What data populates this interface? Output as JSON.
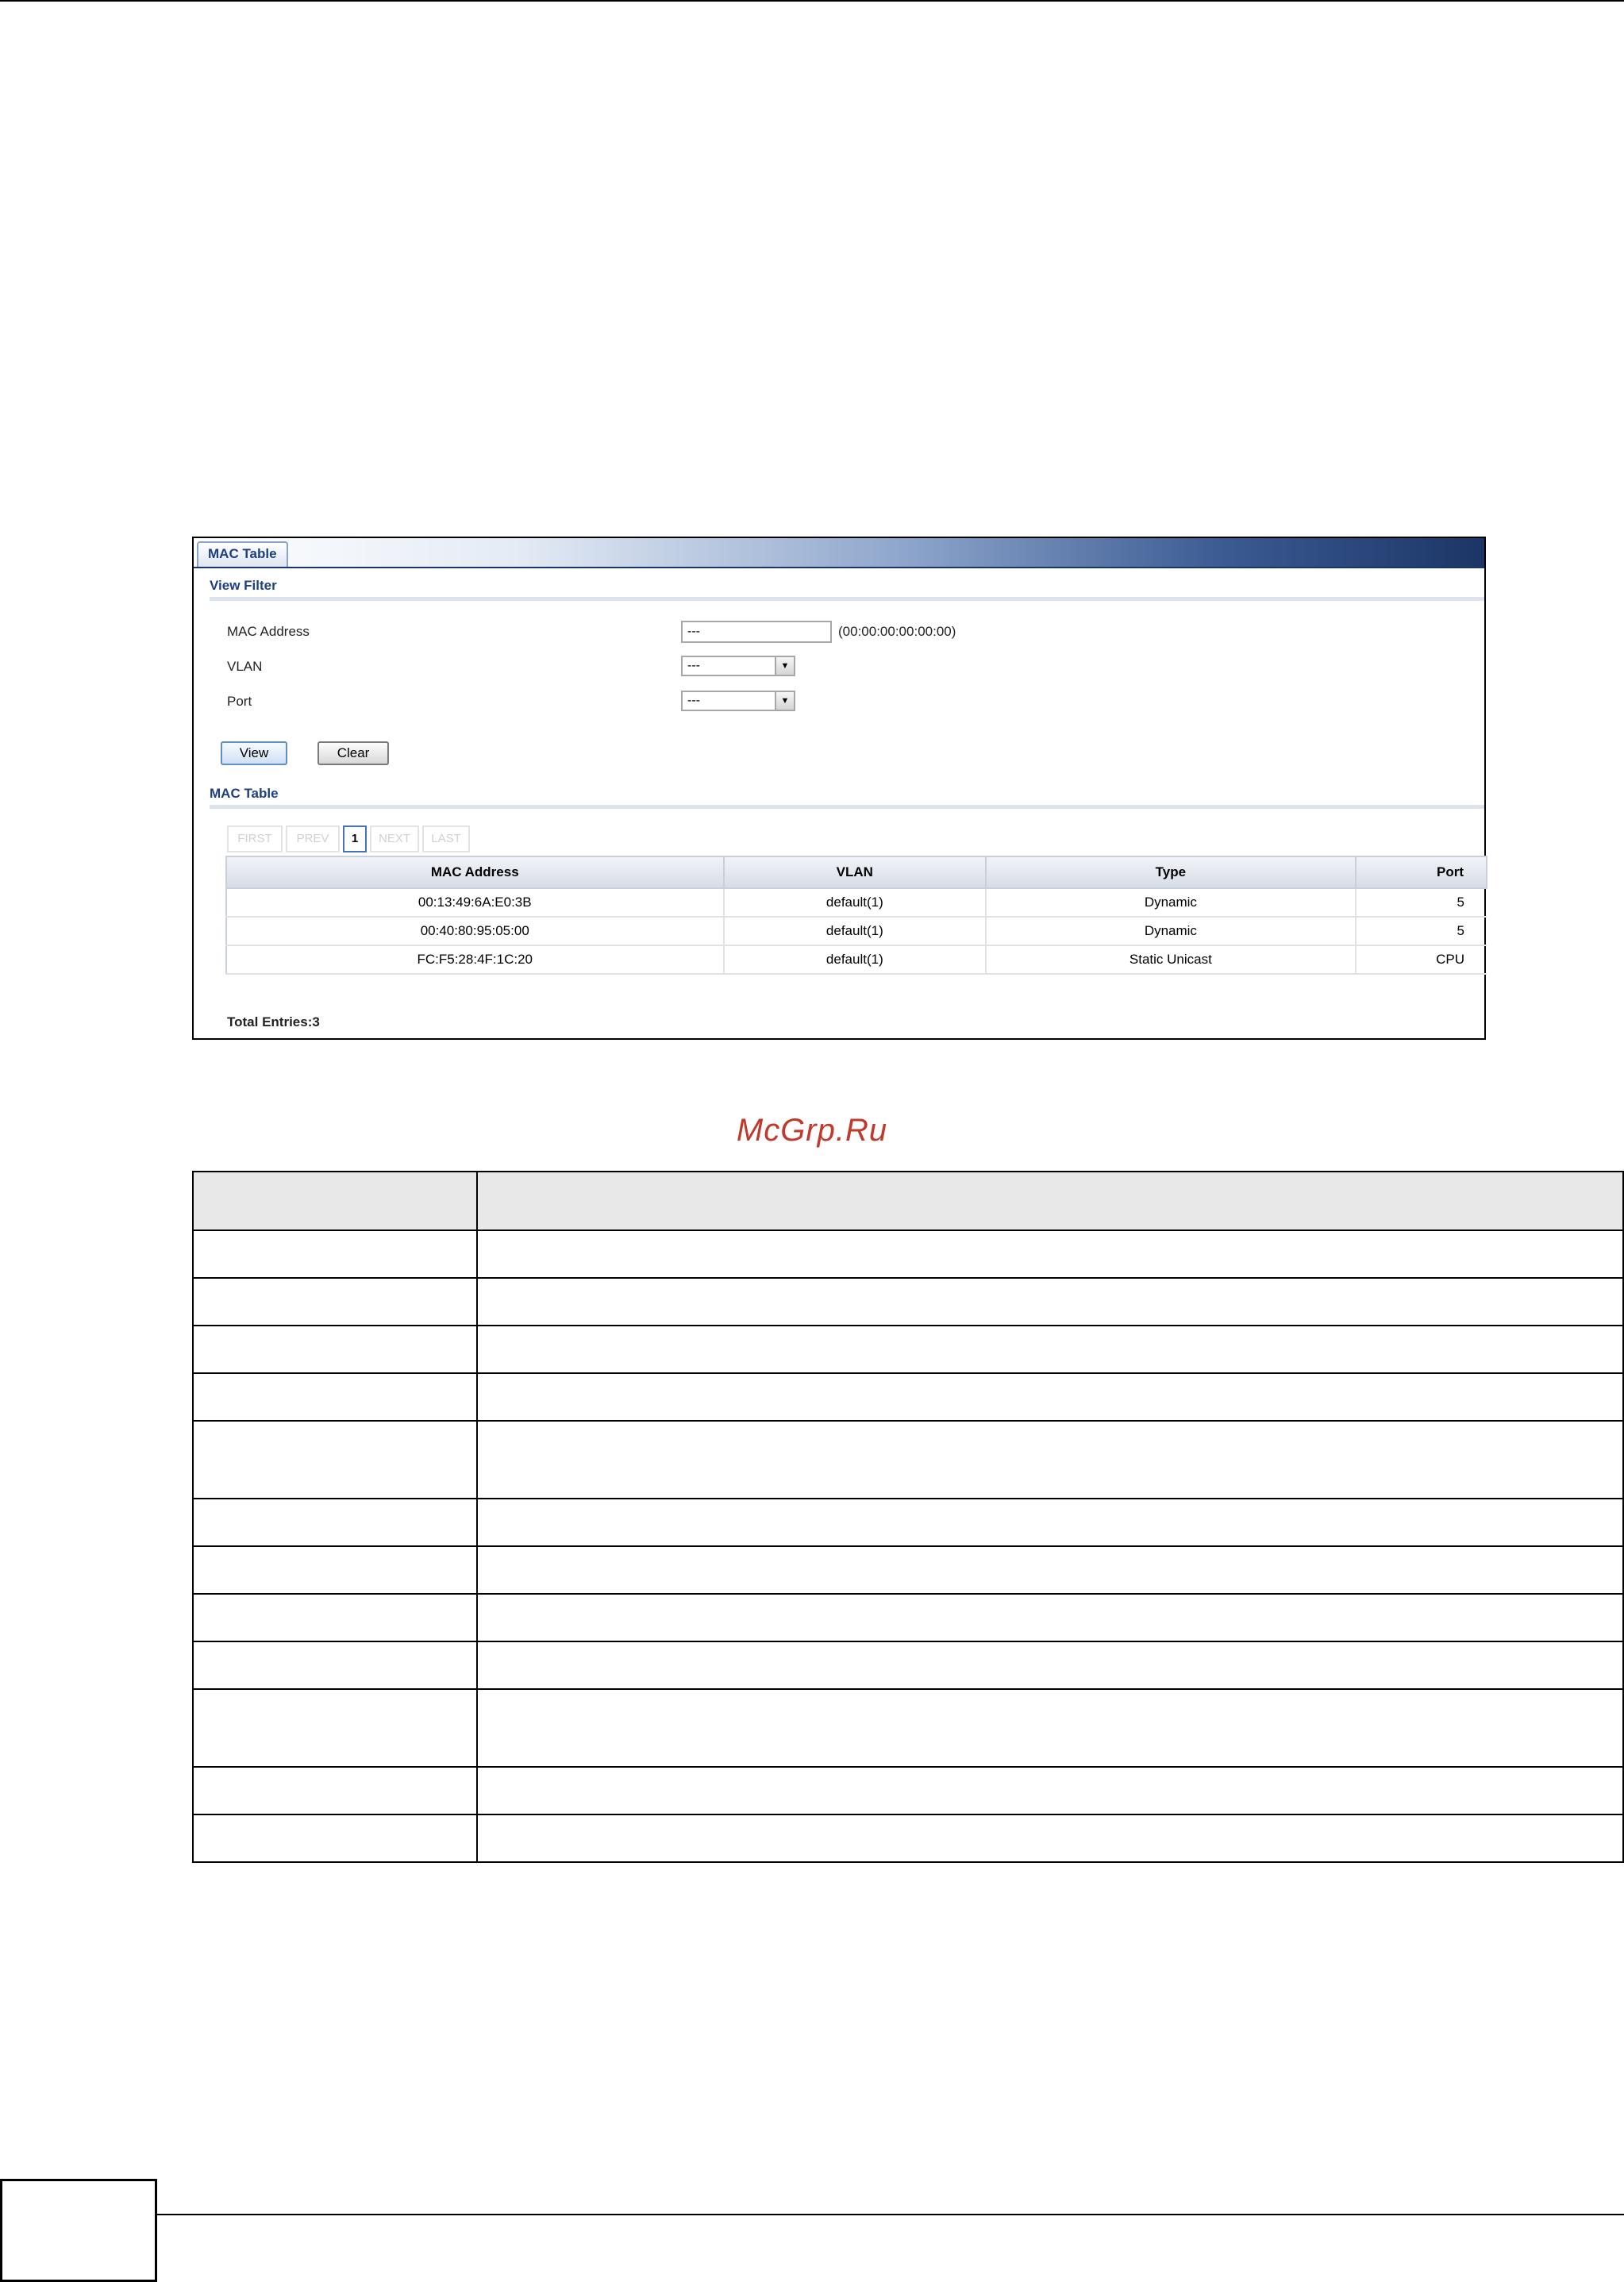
{
  "screenshot": {
    "tab_title": "MAC Table",
    "view_filter": {
      "section_title": "View Filter",
      "mac_address_label": "MAC Address",
      "mac_address_value": "---",
      "mac_address_hint": "(00:00:00:00:00:00)",
      "vlan_label": "VLAN",
      "vlan_value": "---",
      "port_label": "Port",
      "port_value": "---",
      "view_button": "View",
      "clear_button": "Clear"
    },
    "mac_table": {
      "section_title": "MAC Table",
      "pager": {
        "first": "FIRST",
        "prev": "PREV",
        "current": "1",
        "next": "NEXT",
        "last": "LAST"
      },
      "columns": [
        "MAC Address",
        "VLAN",
        "Type",
        "Port"
      ],
      "rows": [
        [
          "00:13:49:6A:E0:3B",
          "default(1)",
          "Dynamic",
          "5"
        ],
        [
          "00:40:80:95:05:00",
          "default(1)",
          "Dynamic",
          "5"
        ],
        [
          "FC:F5:28:4F:1C:20",
          "default(1)",
          "Static Unicast",
          "CPU"
        ]
      ],
      "total_entries": "Total Entries:3"
    }
  },
  "watermark": "McGrp.Ru",
  "description_table": {
    "row_count": 12
  }
}
